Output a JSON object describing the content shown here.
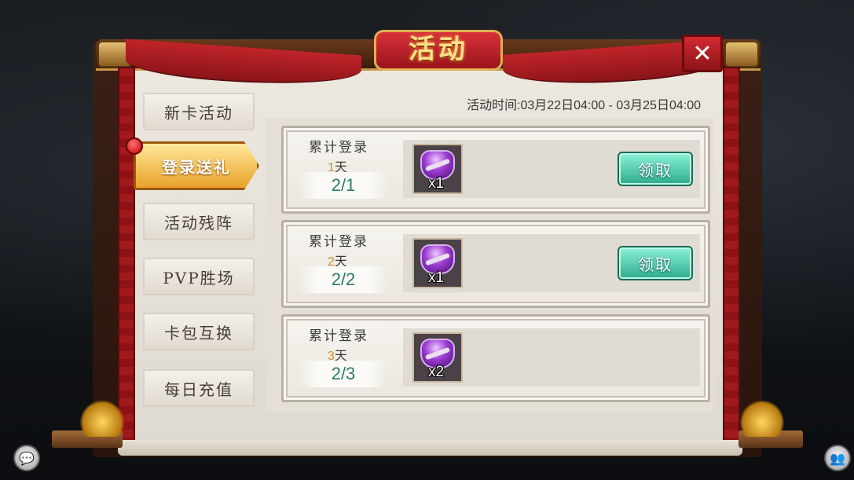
{
  "title": "活动",
  "close_label": "✕",
  "event_time": "活动时间:03月22日04:00 - 03月25日04:00",
  "tabs": [
    {
      "label": "新卡活动",
      "active": false
    },
    {
      "label": "登录送礼",
      "active": true
    },
    {
      "label": "活动残阵",
      "active": false
    },
    {
      "label": "PVP胜场",
      "active": false
    },
    {
      "label": "卡包互换",
      "active": false
    },
    {
      "label": "每日充值",
      "active": false
    }
  ],
  "rewards": [
    {
      "label": "累计登录",
      "days_num": "1",
      "days_unit": "天",
      "progress": "2/1",
      "qty": "x1",
      "button": "领取"
    },
    {
      "label": "累计登录",
      "days_num": "2",
      "days_unit": "天",
      "progress": "2/2",
      "qty": "x1",
      "button": "领取"
    },
    {
      "label": "累计登录",
      "days_num": "3",
      "days_unit": "天",
      "progress": "2/3",
      "qty": "x2",
      "button": ""
    }
  ],
  "icons": {
    "chat": "chat-bubble-icon",
    "social": "friends-icon",
    "reward": "gem-chest-icon"
  },
  "colors": {
    "claim_button": "#2eaa8c",
    "active_tab": "#e8a22a",
    "title_ribbon": "#c0242a",
    "progress_text": "#2a7a70",
    "days_highlight": "#d48a2a"
  }
}
